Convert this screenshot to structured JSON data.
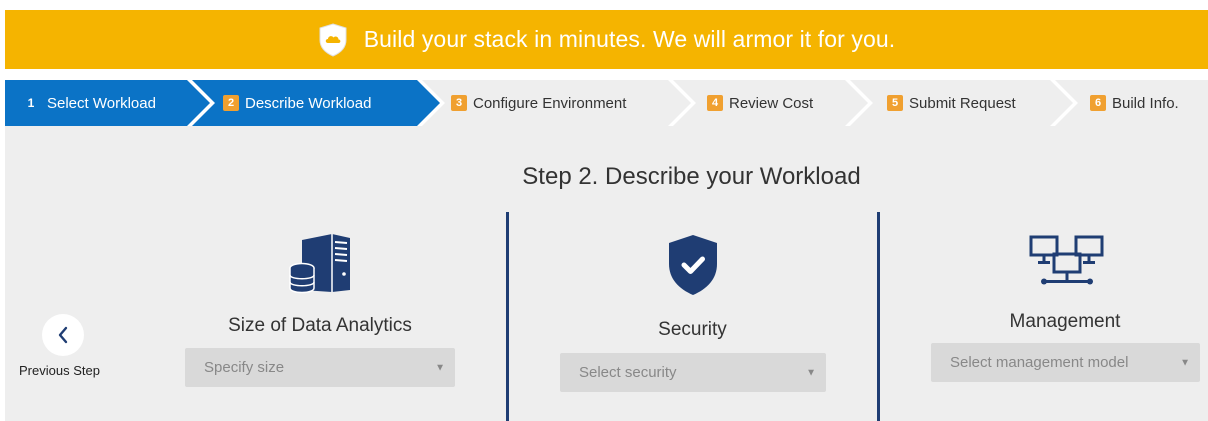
{
  "banner": {
    "text": "Build your stack in minutes. We will armor it for you.",
    "color": "#f5b400",
    "icon": "cloud-shield-icon"
  },
  "steps": [
    {
      "number": "1",
      "label": "Select Workload",
      "state": "done"
    },
    {
      "number": "2",
      "label": "Describe Workload",
      "state": "active"
    },
    {
      "number": "3",
      "label": "Configure Environment",
      "state": "pending"
    },
    {
      "number": "4",
      "label": "Review Cost",
      "state": "pending"
    },
    {
      "number": "5",
      "label": "Submit Request",
      "state": "pending"
    },
    {
      "number": "6",
      "label": "Build Info.",
      "state": "pending"
    }
  ],
  "colors": {
    "step_active": "#0b73c6",
    "step_inactive": "#eeeeee",
    "step_badge": "#f0a030",
    "divider": "#1f3d73",
    "icon": "#1f3d73"
  },
  "main": {
    "title": "Step 2. Describe your Workload",
    "prev": {
      "label": "Previous Step",
      "icon": "chevron-left-icon"
    },
    "columns": [
      {
        "label": "Size of Data Analytics",
        "icon": "server-database-icon",
        "placeholder": "Specify size"
      },
      {
        "label": "Security",
        "icon": "shield-check-icon",
        "placeholder": "Select security"
      },
      {
        "label": "Management",
        "icon": "network-computers-icon",
        "placeholder": "Select management model"
      }
    ]
  }
}
